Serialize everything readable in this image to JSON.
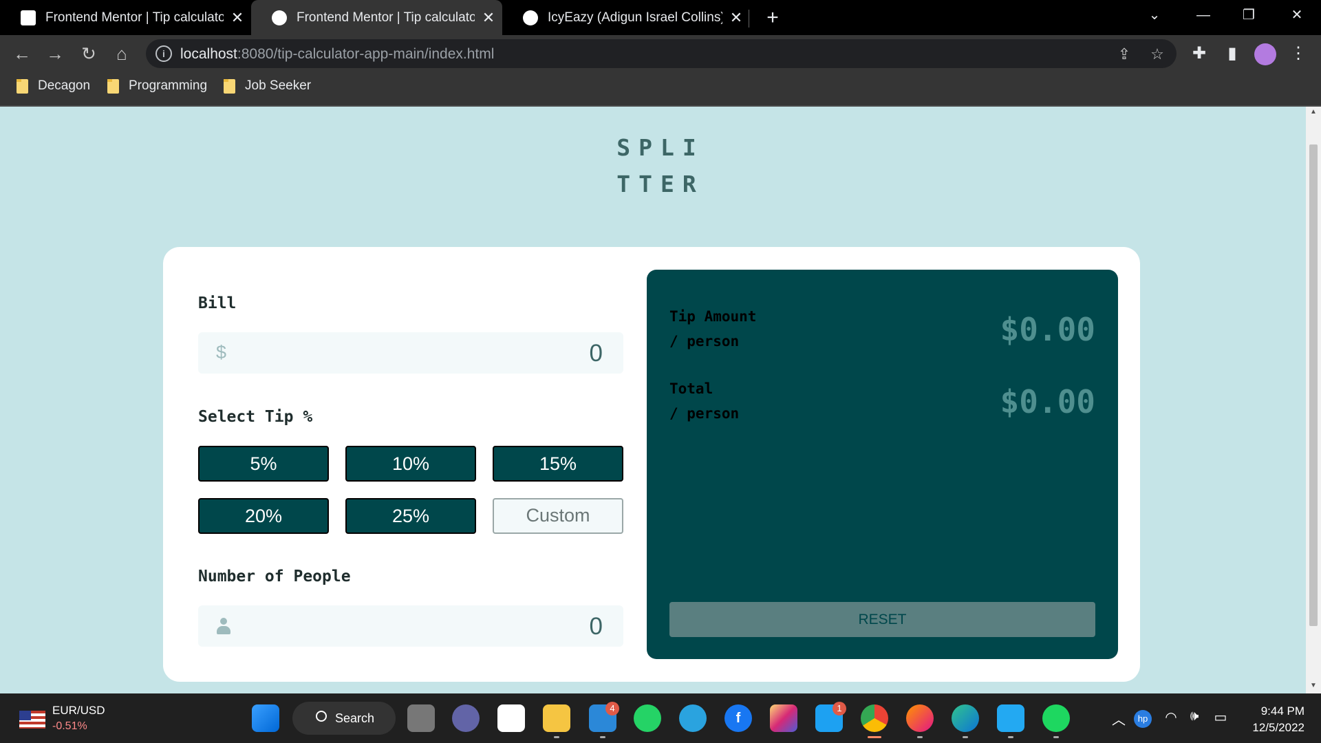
{
  "browser": {
    "tabs": [
      {
        "title": "Frontend Mentor | Tip calculator",
        "active": false
      },
      {
        "title": "Frontend Mentor | Tip calculator",
        "active": true
      },
      {
        "title": "IcyEazy (Adigun Israel Collins)",
        "active": false
      }
    ],
    "url_host": "localhost",
    "url_path": ":8080/tip-calculator-app-main/index.html",
    "bookmarks": [
      "Decagon",
      "Programming",
      "Job Seeker"
    ]
  },
  "app": {
    "logo_line1": "SPLI",
    "logo_line2": "TTER",
    "bill_label": "Bill",
    "bill_prefix": "$",
    "bill_value": "0",
    "tip_label": "Select Tip %",
    "tip_options": [
      "5%",
      "10%",
      "15%",
      "20%",
      "25%"
    ],
    "custom_placeholder": "Custom",
    "people_label": "Number of People",
    "people_value": "0",
    "tip_amount_label": "Tip Amount",
    "tip_amount_sub": "/ person",
    "tip_amount_value": "$0.00",
    "total_label": "Total",
    "total_sub": "/ person",
    "total_value": "$0.00",
    "reset_label": "RESET",
    "colors": {
      "background": "#c5e4e7",
      "panel": "#00474b",
      "button": "#00474b",
      "result": "#4f8f8f"
    }
  },
  "taskbar": {
    "ticker_name": "EUR/USD",
    "ticker_change": "-0.51%",
    "search_label": "Search",
    "mail_badge": "4",
    "twitter_badge": "1",
    "time": "9:44 PM",
    "date": "12/5/2022"
  }
}
